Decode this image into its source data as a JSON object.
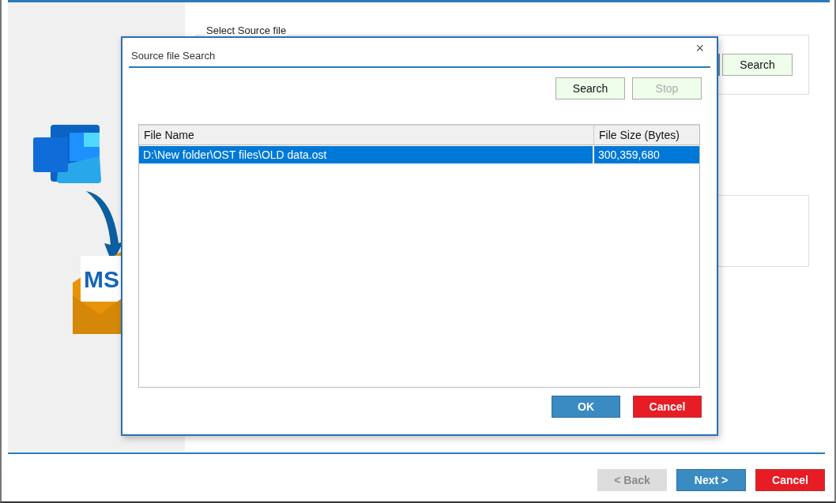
{
  "background": {
    "logo_text": "MS",
    "source_group": {
      "label": "Select Source file",
      "button": "Search"
    },
    "footer_buttons": [
      {
        "label": "< Back",
        "kind": "back",
        "disabled": true
      },
      {
        "label": "Next >",
        "kind": "next",
        "disabled": false
      },
      {
        "label": "Cancel",
        "kind": "cancel",
        "disabled": false
      }
    ]
  },
  "dialog": {
    "title": "Source file Search",
    "close": "×",
    "toolbar": [
      {
        "label": "Search",
        "disabled": false
      },
      {
        "label": "Stop",
        "disabled": true
      }
    ],
    "table": {
      "columns": [
        "File Name",
        "File Size (Bytes)"
      ],
      "rows": [
        {
          "cells": [
            "D:\\New folder\\OST files\\OLD data.ost",
            "300,359,680"
          ],
          "selected": true
        }
      ]
    },
    "buttons": [
      {
        "label": "OK",
        "kind": "ok"
      },
      {
        "label": "Cancel",
        "kind": "cancel"
      }
    ]
  }
}
